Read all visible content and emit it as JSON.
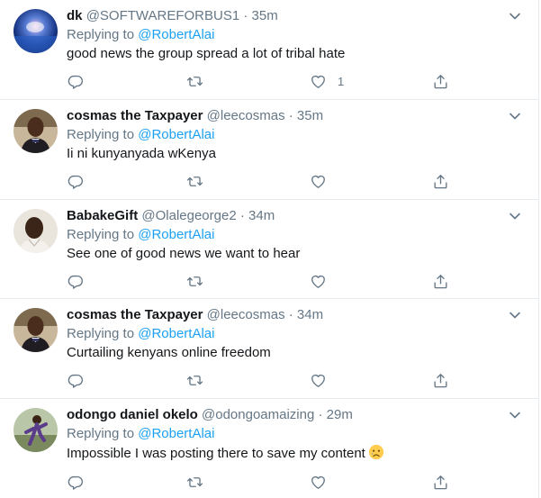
{
  "tweets": [
    {
      "name": "dk",
      "handle": "@SOFTWAREFORBUS1",
      "time": "35m",
      "replying_prefix": "Replying to",
      "replying_to": "@RobertAlai",
      "text": "good news the group spread a lot of tribal hate",
      "like_count": "1"
    },
    {
      "name": "cosmas the Taxpayer",
      "handle": "@leecosmas",
      "time": "35m",
      "replying_prefix": "Replying to",
      "replying_to": "@RobertAlai",
      "text": "Ii ni kunyanyada wKenya",
      "like_count": ""
    },
    {
      "name": "BabakeGift",
      "handle": "@Olalegeorge2",
      "time": "34m",
      "replying_prefix": "Replying to",
      "replying_to": "@RobertAlai",
      "text": "See one of good news we want to hear",
      "like_count": ""
    },
    {
      "name": "cosmas the Taxpayer",
      "handle": "@leecosmas",
      "time": "34m",
      "replying_prefix": "Replying to",
      "replying_to": "@RobertAlai",
      "text": "Curtailing kenyans online freedom",
      "like_count": ""
    },
    {
      "name": "odongo daniel okelo",
      "handle": "@odongoamaizing",
      "time": "29m",
      "replying_prefix": "Replying to",
      "replying_to": "@RobertAlai",
      "text": "Impossible I was posting there to save my content",
      "like_count": ""
    }
  ],
  "separator": "·",
  "colors": {
    "link": "#1da1f2",
    "muted": "#657786",
    "text": "#14171a",
    "border": "#e6ecf0"
  },
  "icons": {
    "reply": "reply-icon",
    "retweet": "retweet-icon",
    "like": "heart-icon",
    "share": "share-icon",
    "more": "chevron-down-icon",
    "emoji": "crying-face-icon"
  }
}
